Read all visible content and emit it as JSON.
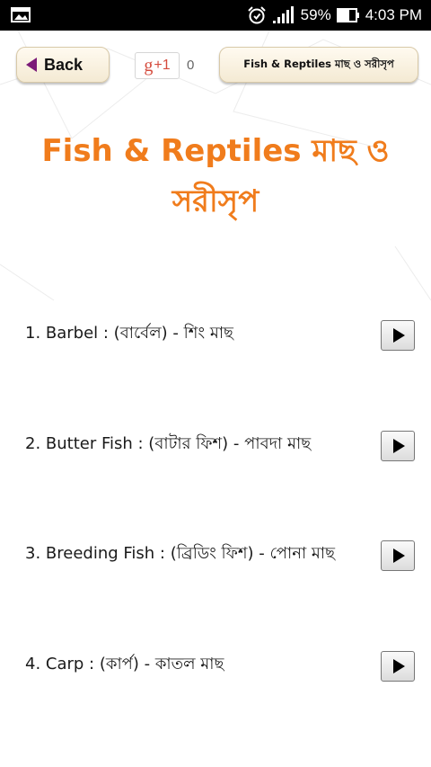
{
  "status_bar": {
    "battery_percent": "59%",
    "time": "4:03 PM"
  },
  "toolbar": {
    "back_label": "Back",
    "gplus_label": "+1",
    "gplus_g": "g",
    "gplus_count": "0",
    "title_chip": "Fish & Reptiles মাছ ও সরীসৃপ"
  },
  "page": {
    "title": "Fish & Reptiles মাছ ও সরীসৃপ"
  },
  "items": [
    {
      "text": "1. Barbel : (বার্বেল) - শিং মাছ"
    },
    {
      "text": "2. Butter Fish : (বাটার ফিশ) - পাবদা মাছ"
    },
    {
      "text": "3. Breeding Fish : (ব্রিডিং ফিশ) - পোনা মাছ"
    },
    {
      "text": "4. Carp : (কার্প) - কাতল মাছ"
    }
  ],
  "colors": {
    "title": "#f07c1c",
    "back_arrow": "#7b1a78"
  }
}
